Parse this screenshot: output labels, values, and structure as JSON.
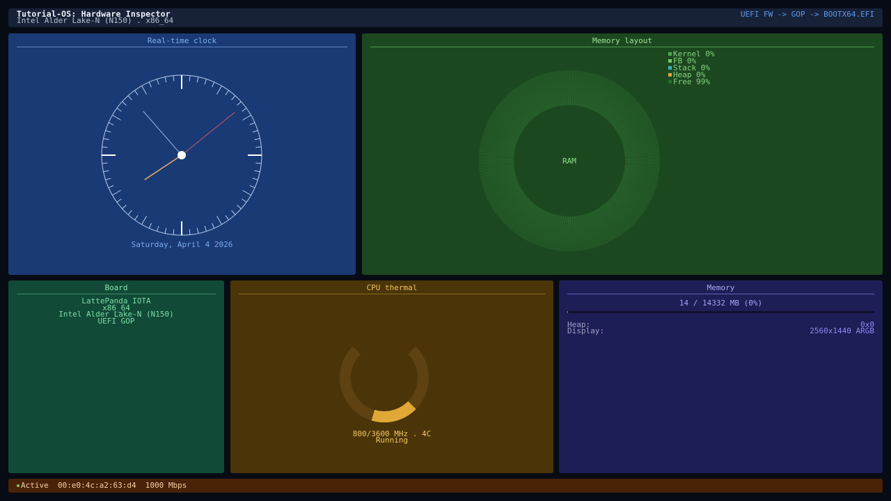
{
  "header": {
    "title": "Tutorial-OS: Hardware Inspector",
    "subtitle": "Intel Alder Lake-N (N150) . x86_64",
    "boot_path": "UEFI FW -> GOP -> BOOTX64.EFI"
  },
  "clock": {
    "title": "Real-time clock",
    "date": "Saturday, April 4 2026",
    "time": {
      "hours": 7,
      "minutes": 53,
      "seconds": 8.5
    }
  },
  "memory_layout": {
    "title": "Memory layout",
    "center_label": "RAM",
    "legend": [
      {
        "label": "Kernel 0%",
        "name": "Kernel",
        "percent": 0,
        "color": "#4caf50"
      },
      {
        "label": "FB 0%",
        "name": "FB",
        "percent": 0,
        "color": "#7cc46f"
      },
      {
        "label": "Stack 0%",
        "name": "Stack",
        "percent": 0,
        "color": "#3ab0c8"
      },
      {
        "label": "Heap 0%",
        "name": "Heap",
        "percent": 0,
        "color": "#e0a040"
      },
      {
        "label": "Free 99%",
        "name": "Free",
        "percent": 99,
        "color": "#2c6a30"
      }
    ]
  },
  "board": {
    "title": "Board",
    "lines": [
      "LattePanda IOTA",
      "x86_64",
      "Intel Alder Lake-N (N150)",
      "UEFI GOP"
    ]
  },
  "cpu": {
    "title": "CPU thermal",
    "freq_text": "800/3600 MHz . 4C",
    "state": "Running",
    "current_mhz": 800,
    "max_mhz": 3600
  },
  "memory": {
    "title": "Memory",
    "usage_text": "14 / 14332 MB (0%)",
    "used_fraction": 0.001,
    "rows": [
      {
        "key": "Heap:",
        "value": "0x0"
      },
      {
        "key": "Display:",
        "value": "2560x1440 ARGB"
      }
    ]
  },
  "status": {
    "text": "Active  00:e0:4c:a2:63:d4  1000 Mbps",
    "dot_color": "#7ec850"
  }
}
